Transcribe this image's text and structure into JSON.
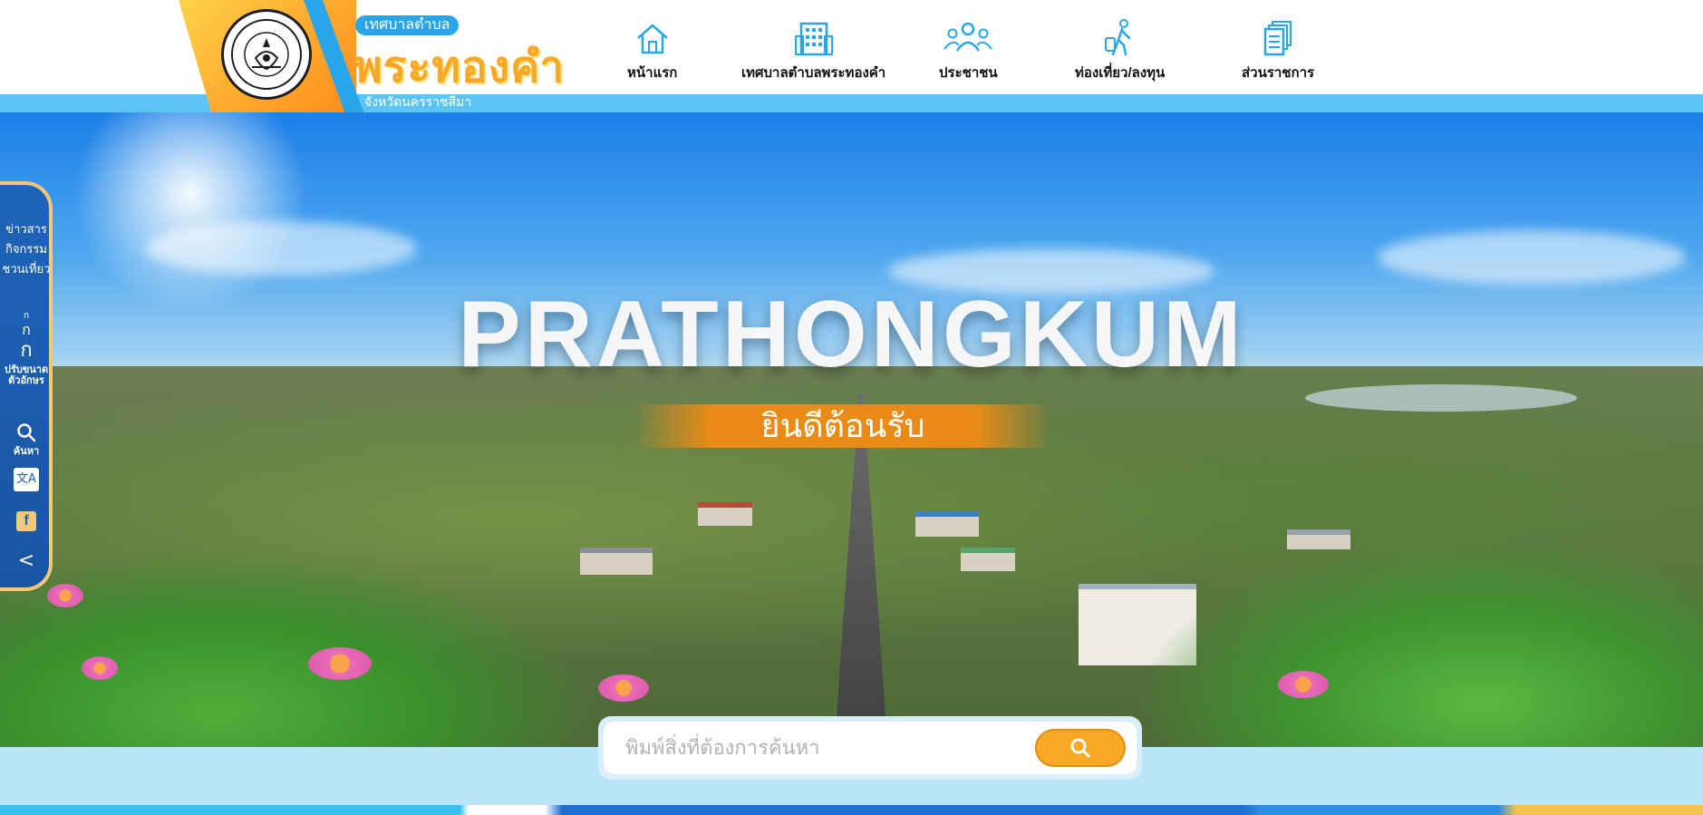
{
  "brand": {
    "tag": "เทศบาลตำบล",
    "name": "พระทองคำ",
    "province": "จังหวัดนครราชสีมา",
    "seal_text": "เทศบาลตำบลพระทองคำ จังหวัดนครราชสีมา"
  },
  "nav": [
    {
      "label": "หน้าแรก",
      "icon": "home-icon"
    },
    {
      "label": "เทศบาลตำบลพระทองคำ",
      "icon": "building-icon"
    },
    {
      "label": "ประชาชน",
      "icon": "people-icon"
    },
    {
      "label": "ท่องเที่ยว/ลงทุน",
      "icon": "traveler-icon"
    },
    {
      "label": "ส่วนราชการ",
      "icon": "documents-icon"
    }
  ],
  "hero": {
    "title": "PRATHONGKUM",
    "banner": "ยินดีต้อนรับ"
  },
  "sidebar": {
    "links": [
      "ข่าวสาร",
      "กิจกรรม",
      "ชวนเที่ยว"
    ],
    "font_size_label": "ปรับขนาดตัวอักษร",
    "font_small": "ก",
    "font_medium": "ก",
    "font_large": "ก",
    "search_label": "ค้นหา",
    "translate_glyph": "文A",
    "facebook_glyph": "f",
    "collapse_glyph": "<"
  },
  "search": {
    "placeholder": "พิมพ์สิ่งที่ต้องการค้นหา"
  },
  "colors": {
    "brand_orange": "#f7a824",
    "brand_blue": "#2aa6e8",
    "sidebar_blue": "#1e64b8",
    "sidebar_border": "#f3c878",
    "search_button": "#f7a924"
  }
}
